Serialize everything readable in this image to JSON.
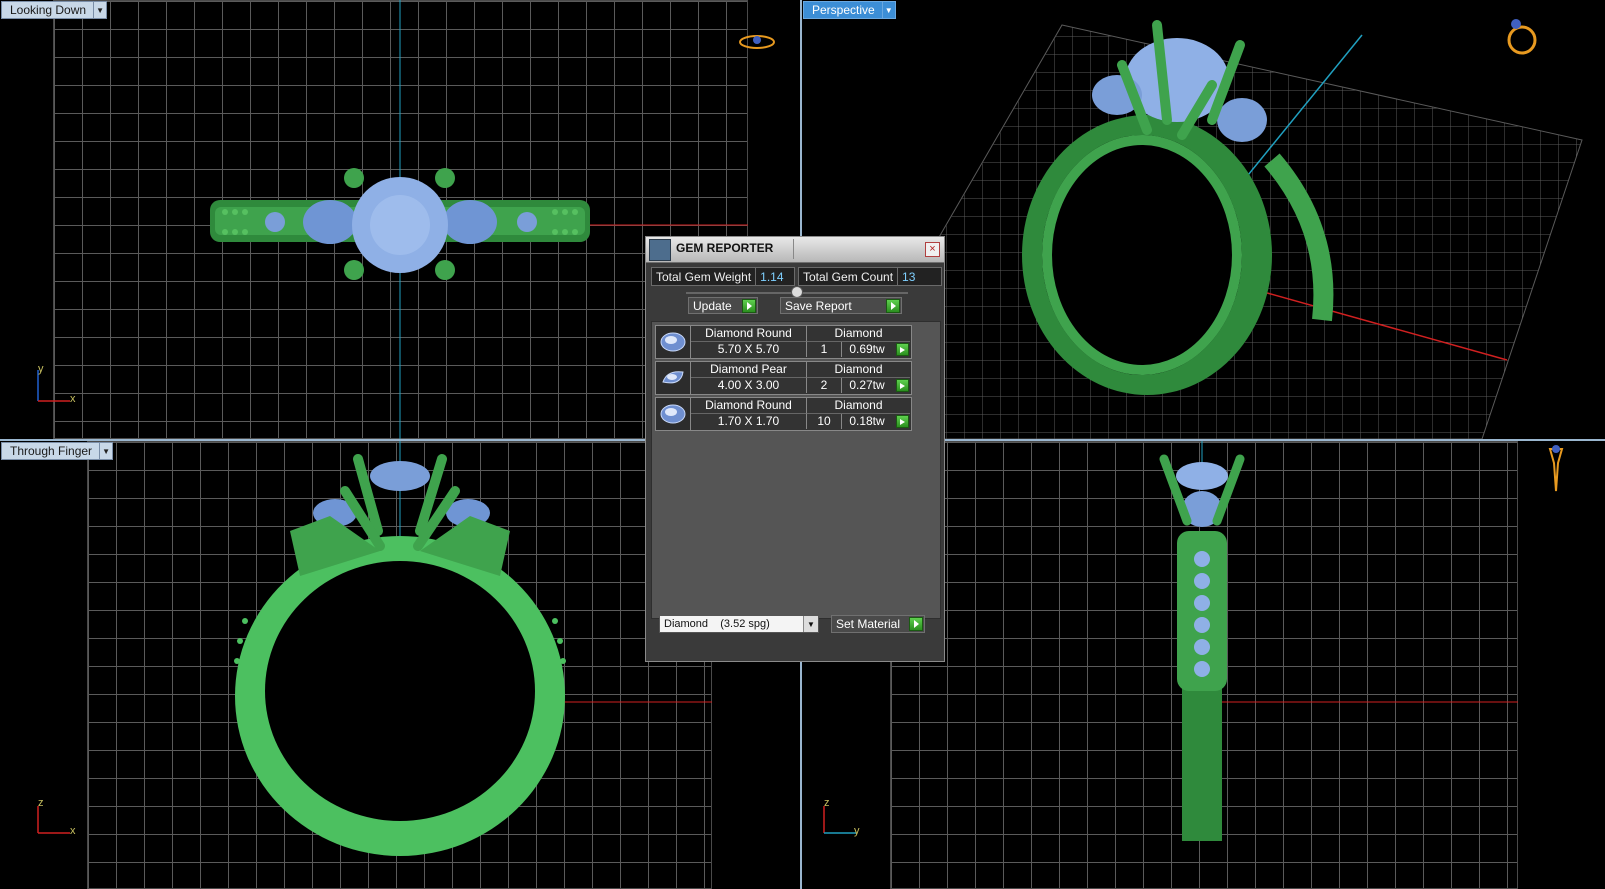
{
  "viewports": {
    "top_left": {
      "label": "Looking Down",
      "axis_v": "y",
      "axis_h": "x"
    },
    "top_right": {
      "label": "Perspective"
    },
    "bottom_left": {
      "label": "Through Finger",
      "axis_v": "z",
      "axis_h": "x"
    },
    "bottom_right": {
      "axis_v": "z",
      "axis_h": "y"
    }
  },
  "gem_reporter": {
    "title": "GEM REPORTER",
    "close_label": "×",
    "total_weight_label": "Total Gem Weight",
    "total_weight_value": "1.14",
    "total_count_label": "Total Gem Count",
    "total_count_value": "13",
    "update_label": "Update",
    "save_report_label": "Save Report",
    "gems": [
      {
        "name": "Diamond Round",
        "size": "5.70 X 5.70",
        "material": "Diamond",
        "qty": "1",
        "weight": "0.69tw"
      },
      {
        "name": "Diamond Pear",
        "size": "4.00 X 3.00",
        "material": "Diamond",
        "qty": "2",
        "weight": "0.27tw"
      },
      {
        "name": "Diamond Round",
        "size": "1.70 X 1.70",
        "material": "Diamond",
        "qty": "10",
        "weight": "0.18tw"
      }
    ],
    "material_select": "Diamond    (3.52 spg)",
    "set_material_label": "Set Material"
  },
  "colors": {
    "ring_green": "#3fa34d",
    "gem_blue": "#7a9ed8",
    "axis_red": "#d02020",
    "axis_cyan": "#20a0c0"
  }
}
